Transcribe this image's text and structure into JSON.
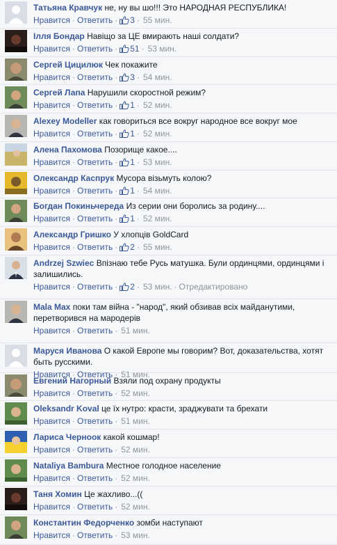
{
  "comments": [
    {
      "author": "Татьяна Кравчук",
      "text": "не, ну вы шо!!! Это НАРОДНАЯ РЕСПУБЛИКА!",
      "like_label": "Нравится",
      "reply_label": "Ответить",
      "likes": "3",
      "time": "55 мин.",
      "avatar": "female-generic"
    },
    {
      "author": "Ілля Бондар",
      "text": "Навіщо за ЦЕ вмирають наші солдати?",
      "like_label": "Нравится",
      "reply_label": "Ответить",
      "likes": "51",
      "time": "53 мин.",
      "avatar": "dark-photo"
    },
    {
      "author": "Сергей Цицилюк",
      "text": "Чек покажите",
      "like_label": "Нравится",
      "reply_label": "Ответить",
      "likes": "3",
      "time": "54 мин.",
      "avatar": "man-photo"
    },
    {
      "author": "Сергей Лапа",
      "text": "Нарушили скоростной режим?",
      "like_label": "Нравится",
      "reply_label": "Ответить",
      "likes": "1",
      "time": "52 мин.",
      "avatar": "man-outdoor"
    },
    {
      "author": "Alexey Modeller",
      "text": "как говориться все вокруг народное все вокруг мое",
      "like_label": "Нравится",
      "reply_label": "Ответить",
      "likes": "1",
      "time": "52 мин.",
      "avatar": "man-portrait"
    },
    {
      "author": "Алена Пахомова",
      "text": "Позорище какое....",
      "like_label": "Нравится",
      "reply_label": "Ответить",
      "likes": "1",
      "time": "53 мин.",
      "avatar": "field-photo"
    },
    {
      "author": "Олександр Каспрук",
      "text": "Мусора візьмуть колою?",
      "like_label": "Нравится",
      "reply_label": "Ответить",
      "likes": "1",
      "time": "54 мин.",
      "avatar": "yellow-photo"
    },
    {
      "author": "Богдан Покиньчереда",
      "text": "Из серии они боролись за родину....",
      "like_label": "Нравится",
      "reply_label": "Ответить",
      "likes": "1",
      "time": "52 мин.",
      "avatar": "man-outdoor"
    },
    {
      "author": "Александр Гришко",
      "text": "У хлопців GoldCard",
      "like_label": "Нравится",
      "reply_label": "Ответить",
      "likes": "2",
      "time": "55 мин.",
      "avatar": "warm-photo"
    },
    {
      "author": "Andrzej Szwiec",
      "text": "Впізнаю тебе Русь матушка. Були ординцями, ординцями і залишились.",
      "like_label": "Нравится",
      "reply_label": "Ответить",
      "likes": "2",
      "time": "53 мин.",
      "edited": "Отредактировано",
      "avatar": "man-suit"
    },
    {
      "author": "Mala Max",
      "text": "поки там війна - \"народ\", який обзивав всіх майданутими, перетворився на мародерів",
      "like_label": "Нравится",
      "reply_label": "Ответить",
      "likes": "",
      "time": "51 мин.",
      "avatar": "man-portrait"
    },
    {
      "author": "Маруся Иванова",
      "text": "О какой Европе мы говорим? Вот, доказательства, хотят быть русскими.",
      "like_label": "Нравится",
      "reply_label": "Ответить",
      "likes": "",
      "time": "51 мин.",
      "avatar": "female-generic"
    },
    {
      "author": "Евгений Нагорный",
      "text": "Взяли под охрану продукты",
      "like_label": "Нравится",
      "reply_label": "Ответить",
      "likes": "",
      "time": "52 мин.",
      "avatar": "man-photo"
    },
    {
      "author": "Oleksandr Koval",
      "text": "це їх нутро: красти, зраджувати та брехати",
      "like_label": "Нравится",
      "reply_label": "Ответить",
      "likes": "",
      "time": "51 мин.",
      "avatar": "nature-photo"
    },
    {
      "author": "Лариса Черноок",
      "text": "какой кошмар!",
      "like_label": "Нравится",
      "reply_label": "Ответить",
      "likes": "",
      "time": "52 мин.",
      "avatar": "blue-yellow"
    },
    {
      "author": "Nataliya Bambura",
      "text": "Местное голодное население",
      "like_label": "Нравится",
      "reply_label": "Ответить",
      "likes": "",
      "time": "52 мин.",
      "avatar": "nature-photo"
    },
    {
      "author": "Таня Хомин",
      "text": "Це жахливо...((",
      "like_label": "Нравится",
      "reply_label": "Ответить",
      "likes": "",
      "time": "52 мин.",
      "avatar": "dark-photo"
    },
    {
      "author": "Константин Федорченко",
      "text": "зомби наступают",
      "like_label": "Нравится",
      "reply_label": "Ответить",
      "likes": "",
      "time": "53 мин.",
      "avatar": "man-outdoor"
    }
  ]
}
